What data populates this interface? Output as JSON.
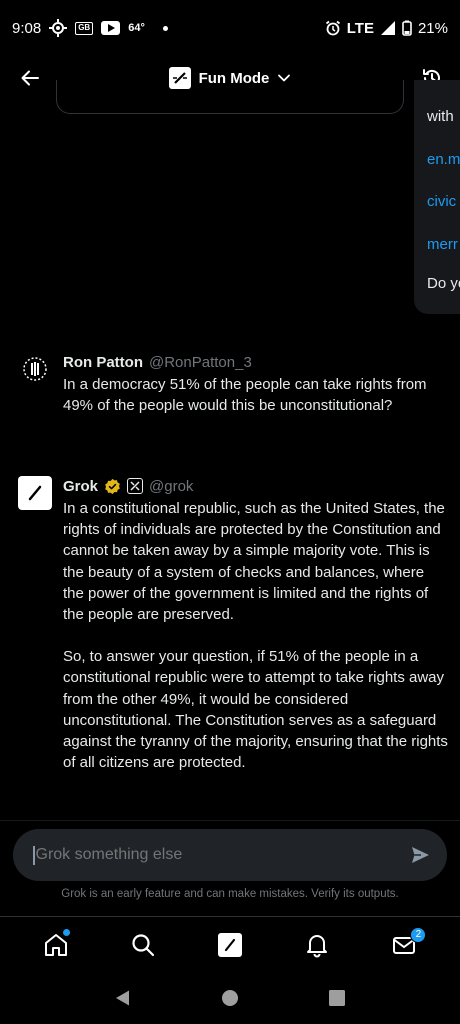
{
  "status_bar": {
    "time": "9:08",
    "temperature": "64°",
    "network": "LTE",
    "battery": "21%",
    "gb_label": "GB"
  },
  "header": {
    "mode_label": "Fun Mode",
    "logo_icon": "grok-logo-icon"
  },
  "previous_card": {
    "lines": [
      "with",
      "en.m",
      "civic",
      "merr",
      "Do yo"
    ]
  },
  "messages": [
    {
      "author": "Ron Patton",
      "handle": "@RonPatton_3",
      "text": "In a democracy 51% of the people can take rights from 49% of the people would this be unconstitutional?"
    },
    {
      "author": "Grok",
      "handle": "@grok",
      "paragraphs": [
        "In a constitutional republic, such as the United States, the rights of individuals are protected by the Constitution and cannot be taken away by a simple majority vote. This is the beauty of a system of checks and balances, where the power of the government is limited and the rights of the people are preserved.",
        "So, to answer your question, if 51% of the people in a constitutional republic were to attempt to take rights away from the other 49%, it would be considered unconstitutional. The Constitution serves as a safeguard against the tyranny of the majority, ensuring that the rights of all citizens are protected."
      ]
    }
  ],
  "composer": {
    "placeholder": "Grok something else",
    "disclaimer": "Grok is an early feature and can make mistakes. Verify its outputs."
  },
  "bottom_nav": {
    "messages_badge": "2"
  },
  "colors": {
    "background": "#000000",
    "accent": "#1d9bf0",
    "muted": "#71767b",
    "text": "#e7e9ea"
  }
}
